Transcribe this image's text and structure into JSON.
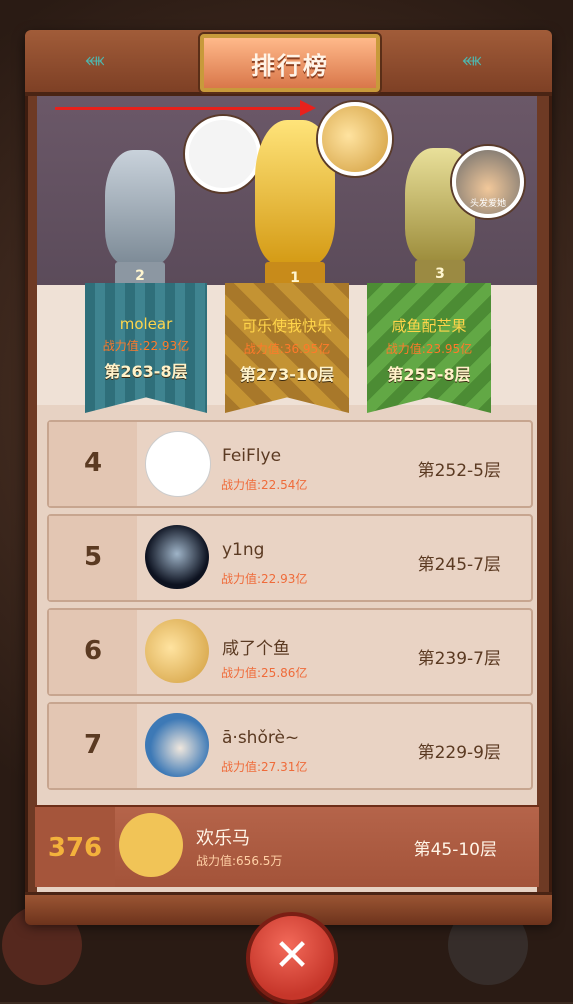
{
  "header": {
    "title": "排行榜"
  },
  "podium": [
    {
      "place": "2",
      "name": "molear",
      "power": "战力值:22.93亿",
      "floor": "第263-8层"
    },
    {
      "place": "1",
      "name": "可乐使我快乐",
      "power": "战力值:36.95亿",
      "floor": "第273-10层"
    },
    {
      "place": "3",
      "name": "咸鱼配芒果",
      "power": "战力值:23.95亿",
      "floor": "第255-8层",
      "avatar_caption": "头发爱她"
    }
  ],
  "rows": [
    {
      "rank": "4",
      "name": "FeiFlye",
      "power": "战力值:22.54亿",
      "floor": "第252-5层"
    },
    {
      "rank": "5",
      "name": "y1ng",
      "power": "战力值:22.93亿",
      "floor": "第245-7层"
    },
    {
      "rank": "6",
      "name": "咸了个鱼",
      "power": "战力值:25.86亿",
      "floor": "第239-7层"
    },
    {
      "rank": "7",
      "name": "ā·shǒrè~",
      "power": "战力值:27.31亿",
      "floor": "第229-9层"
    }
  ],
  "me": {
    "rank": "376",
    "name": "欢乐马",
    "power": "战力值:656.5万",
    "floor": "第45-10层"
  },
  "colors": {
    "accent": "#e8211c",
    "gold": "#f3b23c",
    "panel": "#6e3a24"
  },
  "icons": {
    "close": "close-icon",
    "fish": "fish-emblem-icon"
  }
}
